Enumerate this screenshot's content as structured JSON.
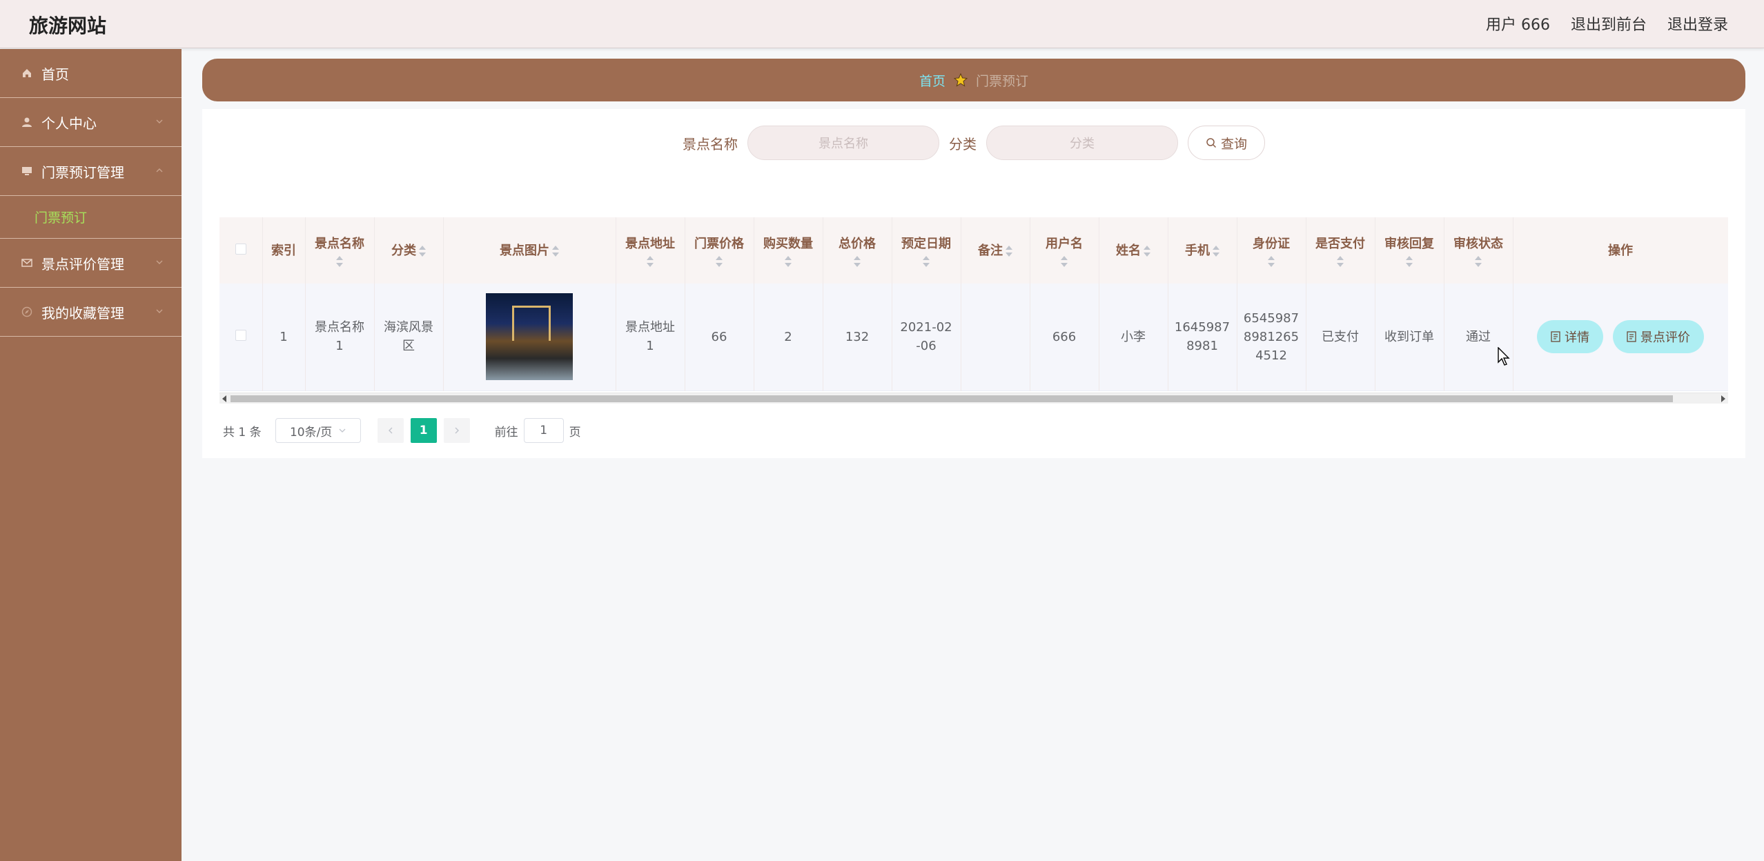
{
  "header": {
    "brand": "旅游网站",
    "user_label": "用户 666",
    "to_front": "退出到前台",
    "logout": "退出登录"
  },
  "sidebar": {
    "items": [
      {
        "label": "首页",
        "icon": "home-icon"
      },
      {
        "label": "个人中心",
        "icon": "user-icon"
      },
      {
        "label": "门票预订管理",
        "icon": "monitor-icon"
      },
      {
        "label": "景点评价管理",
        "icon": "mail-icon"
      },
      {
        "label": "我的收藏管理",
        "icon": "compass-icon"
      }
    ],
    "sub_label": "门票预订"
  },
  "breadcrumb": {
    "home": "首页",
    "current": "门票预订",
    "icon": "star-icon"
  },
  "search": {
    "name_label": "景点名称",
    "name_placeholder": "景点名称",
    "cat_label": "分类",
    "cat_placeholder": "分类",
    "button": "查询"
  },
  "table": {
    "columns": [
      "索引",
      "景点名称",
      "分类",
      "景点图片",
      "景点地址",
      "门票价格",
      "购买数量",
      "总价格",
      "预定日期",
      "备注",
      "用户名",
      "姓名",
      "手机",
      "身份证",
      "是否支付",
      "审核回复",
      "审核状态",
      "操作"
    ],
    "rows": [
      {
        "index": "1",
        "name_l1": "景点名称",
        "name_l2": "1",
        "cat_l1": "海滨风景",
        "cat_l2": "区",
        "addr_l1": "景点地址",
        "addr_l2": "1",
        "price": "66",
        "qty": "2",
        "total": "132",
        "date_l1": "2021-02",
        "date_l2": "-06",
        "note": "",
        "username": "666",
        "realname": "小李",
        "phone_l1": "1645987",
        "phone_l2": "8981",
        "id_l1": "6545987",
        "id_l2": "8981265",
        "id_l3": "4512",
        "paid": "已支付",
        "reply": "收到订单",
        "status": "通过",
        "btn_detail": "详情",
        "btn_review": "景点评价"
      }
    ]
  },
  "pager": {
    "total": "共 1 条",
    "page_size": "10条/页",
    "current": "1",
    "goto_prefix": "前往",
    "goto_value": "1",
    "goto_suffix": "页"
  },
  "colors": {
    "sidebar": "#9e6c51",
    "accent_teal": "#13b78f",
    "button_cyan": "#aeeef3",
    "header_bg": "#f4ecec"
  }
}
